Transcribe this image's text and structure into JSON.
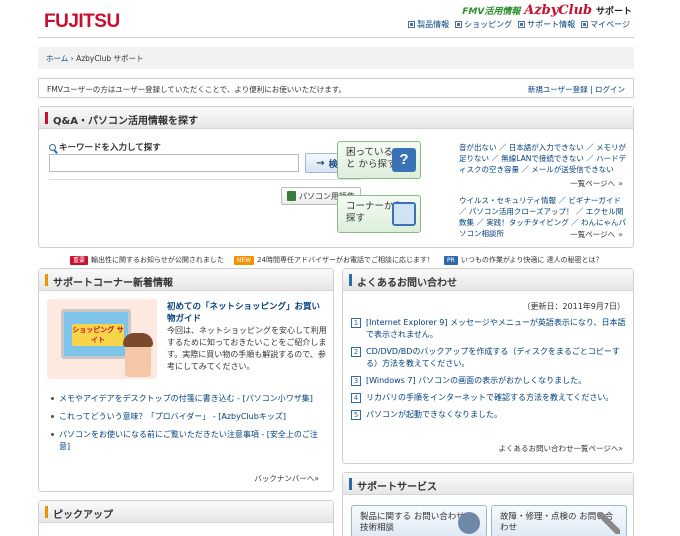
{
  "header": {
    "logo": "FUJITSU",
    "brand_fmv": "FMV活用情報",
    "brand_azby": "AzbyClub",
    "brand_suffix": "サポート",
    "links": [
      {
        "label": "製品情報"
      },
      {
        "label": "ショッピング"
      },
      {
        "label": "サポート情報"
      },
      {
        "label": "マイページ"
      }
    ]
  },
  "breadcrumb": {
    "home": "ホーム",
    "separator": "›",
    "current": "AzbyClub サポート"
  },
  "notice": {
    "message": "FMVユーザーの方はユーザー登録していただくことで、より便利にお使いいただけます。",
    "register": "新規ユーザー登録",
    "divider": "|",
    "login": "ログイン"
  },
  "qa": {
    "title": "Q&A・パソコン活用情報を探す",
    "keyword_label": "キーワードを入力して探す",
    "input_value": "",
    "search_arrow": "→",
    "search_button": "検 索",
    "glossary_button": "パソコン用語集",
    "card1_label": "困っていること から探す",
    "card1_icon": "?",
    "card1_links": "音が出ない ／ 日本語が入力できない ／ メモリが足りない ／ 無線LANで接続できない ／ ハードディスクの空き容量 ／ メールが送受信できない",
    "card1_more": "一覧ページへ",
    "card2_label": "コーナーから 探す",
    "card2_links": "ウイルス・セキュリティ情報 ／ ビギナーガイド ／ パソコン活用クローズアップ！ ／ エクセル関数集 ／ 実践！タッチタイピング ／ わんにゃんパソコン相談所",
    "card2_more": "一覧ページへ",
    "more_chevron": "»"
  },
  "ticker": [
    {
      "tag": "重要",
      "tag_color": "#c8102e",
      "text": "輸出性に関するお知らせが公開されました"
    },
    {
      "tag": "NEW",
      "tag_color": "#f39200",
      "text": "24時間専任アドバイザーがお電話でご相談に応じます！"
    },
    {
      "tag": "PR",
      "tag_color": "#2c6aa8",
      "text": "いつもの作業がより快適に 達人の秘密とは？"
    }
  ],
  "support_corner": {
    "title": "サポートコーナー新着情報",
    "illustration_sign": "ショッピング サイト",
    "feature_title": "初めての「ネットショッピング」お買い物ガイド",
    "feature_body": "今回は、ネットショッピングを安心して利用するために知っておきたいことをご紹介します。実際に買い物の手順も解説するので、参考にしてみてください。",
    "items": [
      {
        "text": "メモやアイデアをデスクトップの付箋に書き込む - [パソコン小ワザ集]"
      },
      {
        "text": "これってどういう意味？「プロバイダー」 - [AzbyClubキッズ]"
      },
      {
        "text": "パソコンをお使いになる前にご覧いただきたい注意事項 - [安全上のご注意]"
      }
    ],
    "back_number": "バックナンバーへ",
    "chevron": "»"
  },
  "faq": {
    "title": "よくあるお問い合わせ",
    "updated": "（更新日：2011年9月7日）",
    "items": [
      {
        "num": "1",
        "text": "[Internet Explorer 9] メッセージやメニューが英語表示になり、日本語で表示されません。"
      },
      {
        "num": "2",
        "text": "CD/DVD/BDのバックアップを作成する（ディスクをまるごとコピーする）方法を教えてください。"
      },
      {
        "num": "3",
        "text": "[Windows 7] パソコンの画面の表示がおかしくなりました。"
      },
      {
        "num": "4",
        "text": "リカバリの手順をインターネットで確認する方法を教えてください。"
      },
      {
        "num": "5",
        "text": "パソコンが起動できなくなりました。"
      }
    ],
    "more": "よくあるお問い合わせ一覧ページへ",
    "chevron": "»"
  },
  "pickup": {
    "title": "ピックアップ"
  },
  "services": {
    "title": "サポートサービス",
    "btn1": "製品に関する お問い合わせ・技術相談",
    "btn2": "故障・修理・点検の お問い合わせ"
  }
}
